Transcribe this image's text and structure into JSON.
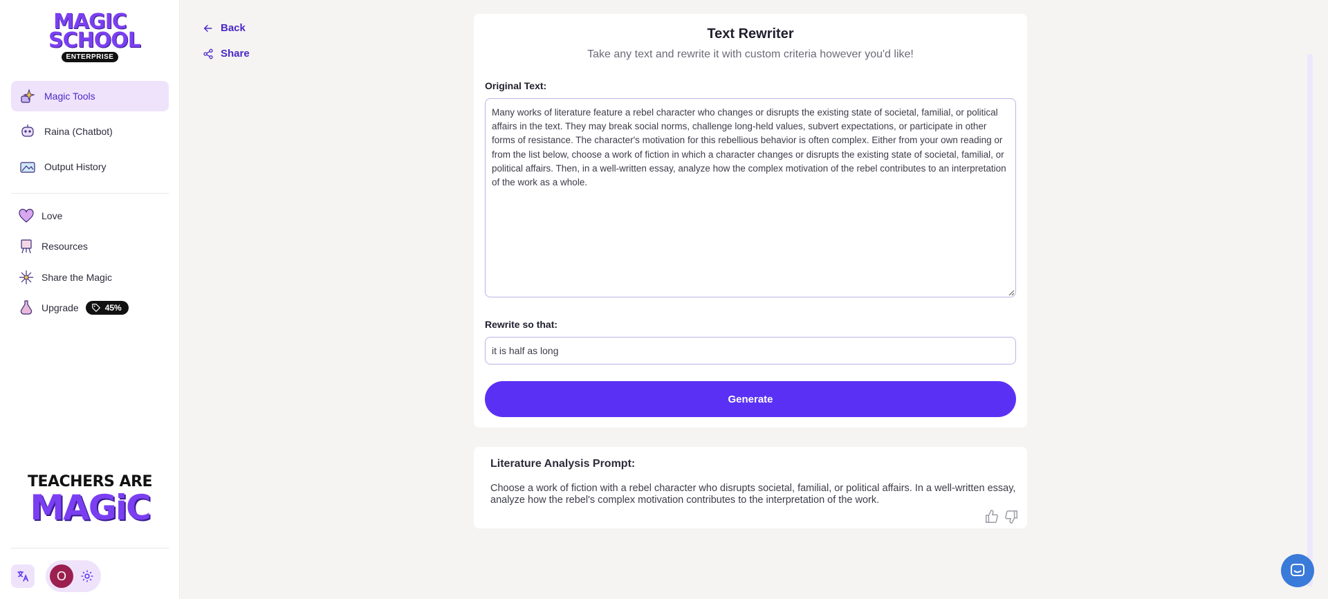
{
  "brand": {
    "logo_line1": "MAGIC",
    "logo_line2": "SCHOOL",
    "logo_badge": "ENTERPRISE",
    "accent": "#5a31f4",
    "purple": "#7b3ff2"
  },
  "sidebar": {
    "items": [
      {
        "label": "Magic Tools",
        "icon": "magic-tools-icon",
        "active": true
      },
      {
        "label": "Raina (Chatbot)",
        "icon": "robot-icon",
        "active": false
      },
      {
        "label": "Output History",
        "icon": "history-icon",
        "active": false
      }
    ],
    "secondary": [
      {
        "label": "Love",
        "icon": "heart-icon"
      },
      {
        "label": "Resources",
        "icon": "easel-icon"
      },
      {
        "label": "Share the Magic",
        "icon": "sparkle-icon"
      },
      {
        "label": "Upgrade",
        "icon": "potion-icon"
      }
    ],
    "upgrade_badge": "45%",
    "promo_line1": "TEACHERS ARE",
    "promo_line2": "MAGiC",
    "avatar_initial": "O"
  },
  "nav": {
    "back_label": "Back",
    "share_label": "Share"
  },
  "tool": {
    "title": "Text Rewriter",
    "subtitle": "Take any text and rewrite it with custom criteria however you'd like!",
    "original_label": "Original Text:",
    "original_value": "Many works of literature feature a rebel character who changes or disrupts the existing state of societal, familial, or political affairs in the text. They may break social norms, challenge long-held values, subvert expectations, or participate in other forms of resistance. The character's motivation for this rebellious behavior is often complex. Either from your own reading or from the list below, choose a work of fiction in which a character changes or disrupts the existing state of societal, familial, or political affairs. Then, in a well-written essay, analyze how the complex motivation of the rebel contributes to an interpretation of the work as a whole.",
    "rewrite_label": "Rewrite so that:",
    "rewrite_value": "it is half as long",
    "generate_label": "Generate"
  },
  "output": {
    "title": "Literature Analysis Prompt:",
    "text": "Choose a work of fiction with a rebel character who disrupts societal, familial, or political affairs. In a well-written essay, analyze how the rebel's complex motivation contributes to the interpretation of the work."
  }
}
